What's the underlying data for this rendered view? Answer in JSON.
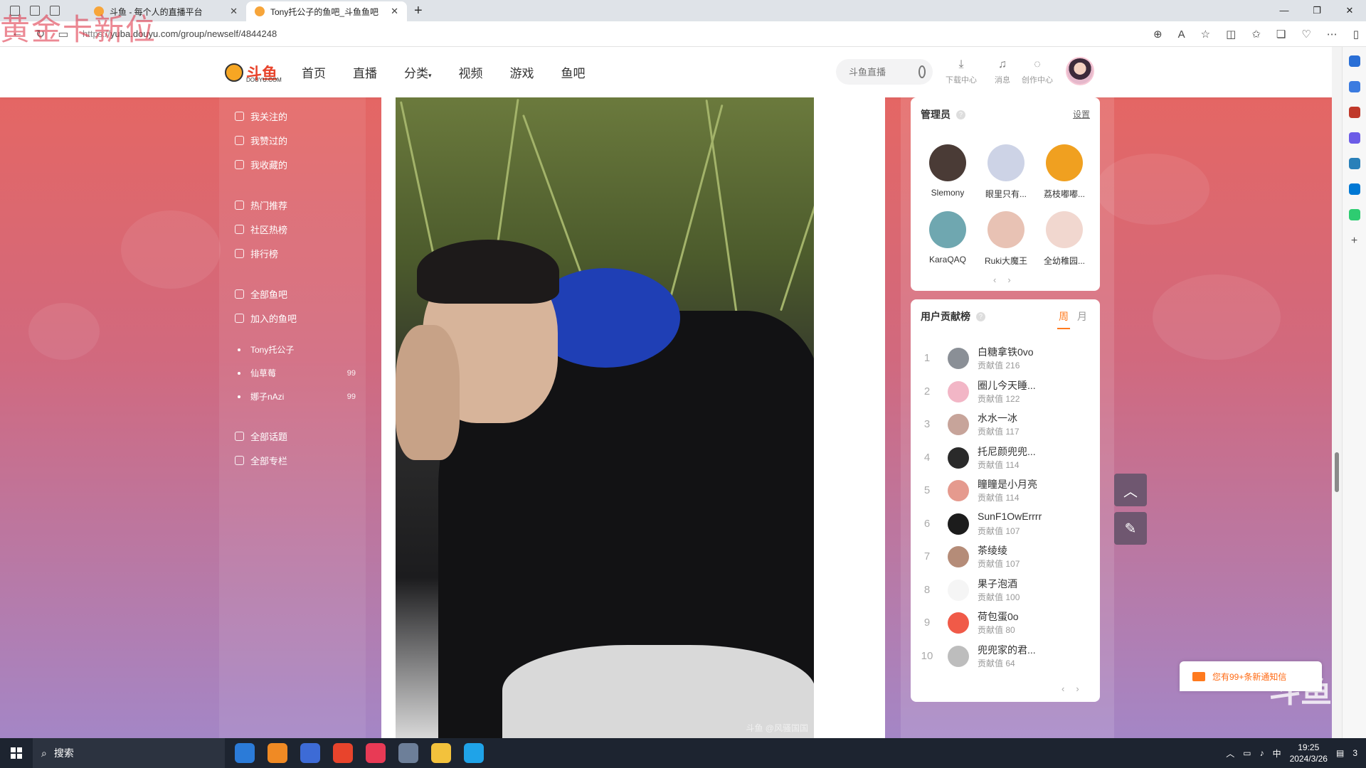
{
  "watermark": "黄金卡新位",
  "browser": {
    "tabs": [
      {
        "title": "斗鱼 - 每个人的直播平台",
        "active": false
      },
      {
        "title": "Tony托公子的鱼吧_斗鱼鱼吧",
        "active": true
      }
    ],
    "url_scheme": "https://",
    "url_rest": "yuba.douyu.com/group/newself/4844248",
    "window_controls": [
      "—",
      "❐",
      "✕"
    ]
  },
  "site": {
    "logo_text": "斗鱼",
    "logo_sub": "DOUYU.COM",
    "nav": [
      "首页",
      "直播",
      "分类",
      "视频",
      "游戏",
      "鱼吧"
    ],
    "search_placeholder": "斗鱼直播",
    "tools": [
      "下载中心",
      "消息",
      "创作中心"
    ]
  },
  "left_menu": {
    "groups": [
      [
        "我关注的",
        "我赞过的",
        "我收藏的"
      ],
      [
        "热门推荐",
        "社区热榜",
        "排行榜"
      ],
      [
        "全部鱼吧",
        "加入的鱼吧"
      ]
    ],
    "joined": [
      {
        "name": "Tony托公子",
        "count": ""
      },
      {
        "name": "仙草莓",
        "count": "99"
      },
      {
        "name": "娜子nAzi",
        "count": "99"
      }
    ],
    "bottom": [
      "全部话题",
      "全部专栏"
    ]
  },
  "photo_watermark": "斗鱼 @风骚国国",
  "admins": {
    "title": "管理员",
    "settings": "设置",
    "list": [
      {
        "name": "Slemony",
        "color": "#4a3b36"
      },
      {
        "name": "眼里只有...",
        "color": "#cdd3e6"
      },
      {
        "name": "荔枝嘟嘟...",
        "color": "#f0a020"
      },
      {
        "name": "KaraQAQ",
        "color": "#6fa7b0"
      },
      {
        "name": "Ruki大魔王",
        "color": "#e8c2b4"
      },
      {
        "name": "全幼稚园...",
        "color": "#f1d7cf"
      }
    ]
  },
  "contrib": {
    "title": "用户贡献榜",
    "tab_week": "周",
    "tab_month": "月",
    "label": "贡献值",
    "rows": [
      {
        "rank": "1",
        "name": "白糖拿铁0vo",
        "value": "216",
        "color": "#8a8f96"
      },
      {
        "rank": "2",
        "name": "圈儿今天睡...",
        "value": "122",
        "color": "#f2b6c6"
      },
      {
        "rank": "3",
        "name": "水水一冰",
        "value": "117",
        "color": "#c7a49a"
      },
      {
        "rank": "4",
        "name": "托尼颜兜兜...",
        "value": "114",
        "color": "#2a2a2a"
      },
      {
        "rank": "5",
        "name": "瞳瞳是小月亮",
        "value": "114",
        "color": "#e59a8e"
      },
      {
        "rank": "6",
        "name": "SunF1OwErrrr",
        "value": "107",
        "color": "#1c1c1c"
      },
      {
        "rank": "7",
        "name": "茶绫绫",
        "value": "107",
        "color": "#b58c78"
      },
      {
        "rank": "8",
        "name": "果子泡酒",
        "value": "100",
        "color": "#f5f5f5"
      },
      {
        "rank": "9",
        "name": "荷包蛋0o",
        "value": "80",
        "color": "#f05a48"
      },
      {
        "rank": "10",
        "name": "兜兜家的君...",
        "value": "64",
        "color": "#bdbdbd"
      }
    ]
  },
  "notice": "您有99+条新通知信",
  "bg_logo": "斗鱼",
  "taskbar": {
    "search": "搜索",
    "time": "19:25",
    "date": "2024/3/26",
    "ime": "中",
    "notif_count": "3",
    "app_colors": [
      "#2b7bd8",
      "#f08a24",
      "#3d6bd6",
      "#e8442c",
      "#e83a55",
      "#6d7f99",
      "#f3c23c",
      "#1fa3e8"
    ]
  }
}
